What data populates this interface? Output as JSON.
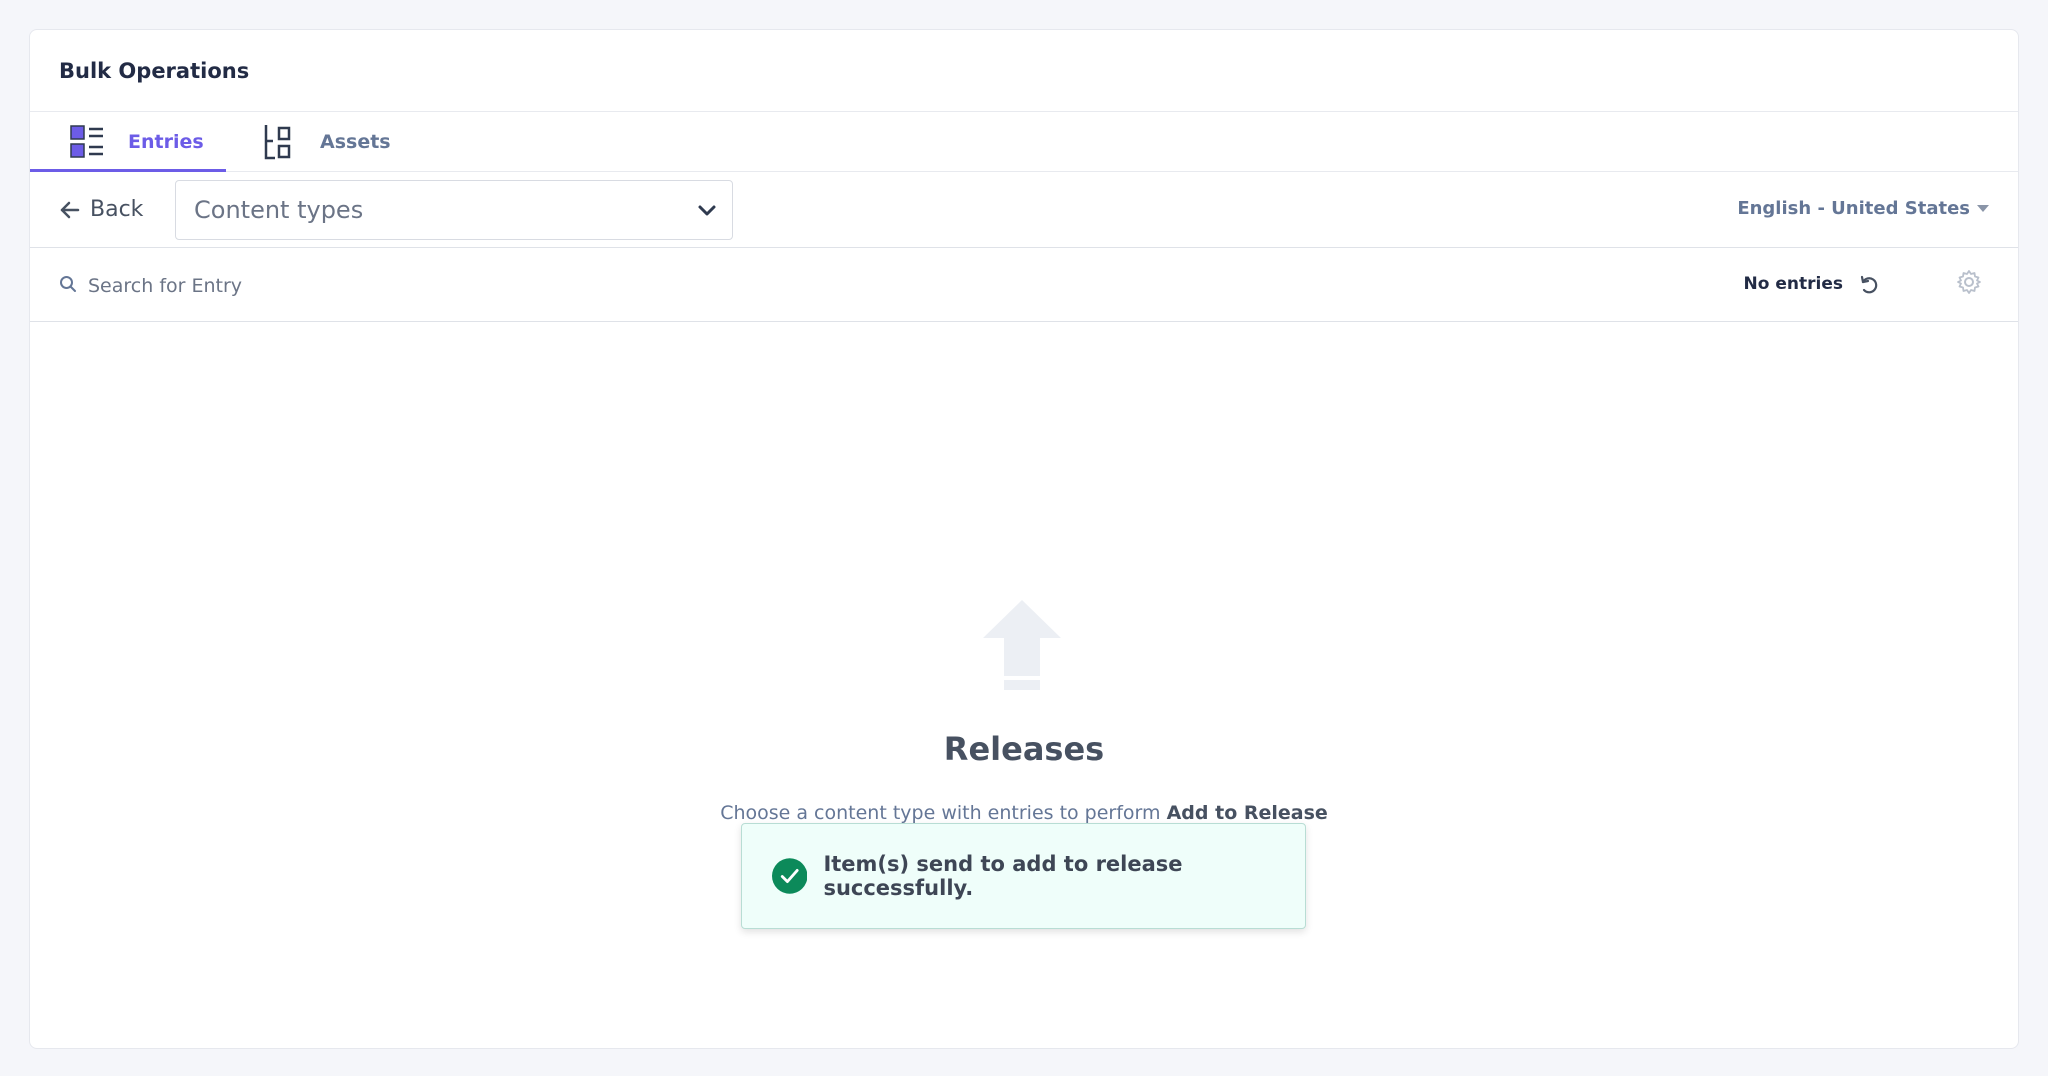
{
  "header": {
    "title": "Bulk Operations"
  },
  "tabs": [
    {
      "label": "Entries",
      "active": true
    },
    {
      "label": "Assets",
      "active": false
    }
  ],
  "toolbar": {
    "back_label": "Back",
    "content_type_select": "Content types",
    "locale": "English - United States"
  },
  "search": {
    "placeholder": "Search for Entry",
    "count_label": "No entries"
  },
  "empty_state": {
    "title": "Releases",
    "description_prefix": "Choose a content type with entries to perform ",
    "description_action": "Add to Release"
  },
  "toast": {
    "message": "Item(s) send to add to release successfully."
  },
  "colors": {
    "accent": "#6c5ce7",
    "success": "#0c8a5a",
    "text": "#475161"
  }
}
